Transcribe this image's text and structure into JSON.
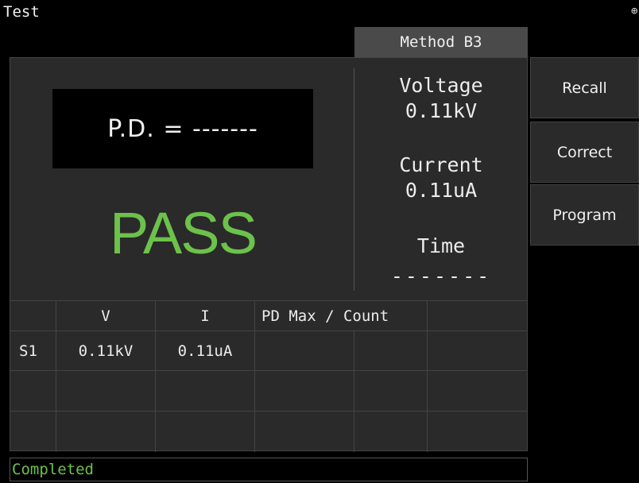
{
  "app": {
    "title": "Test",
    "corner_icon": "⊕"
  },
  "method_tab": {
    "label": "Method B3"
  },
  "pd_display": {
    "text": "P.D. = -------"
  },
  "result": {
    "text": "PASS",
    "color": "#6cc24a"
  },
  "readouts": {
    "voltage_label": "Voltage",
    "voltage_value": "0.11kV",
    "current_label": "Current",
    "current_value": "0.11uA",
    "time_label": "Time",
    "time_value": "-------"
  },
  "table": {
    "headers": [
      "",
      "V",
      "I",
      "PD Max / Count",
      "",
      ""
    ],
    "rows": [
      [
        "S1",
        "0.11kV",
        "0.11uA",
        "",
        "",
        ""
      ],
      [
        "",
        "",
        "",
        "",
        "",
        ""
      ],
      [
        "",
        "",
        "",
        "",
        "",
        ""
      ]
    ]
  },
  "side_buttons": [
    {
      "label": "Recall"
    },
    {
      "label": "Correct"
    },
    {
      "label": "Program"
    }
  ],
  "status": {
    "text": "Completed",
    "color": "#6cc24a"
  }
}
